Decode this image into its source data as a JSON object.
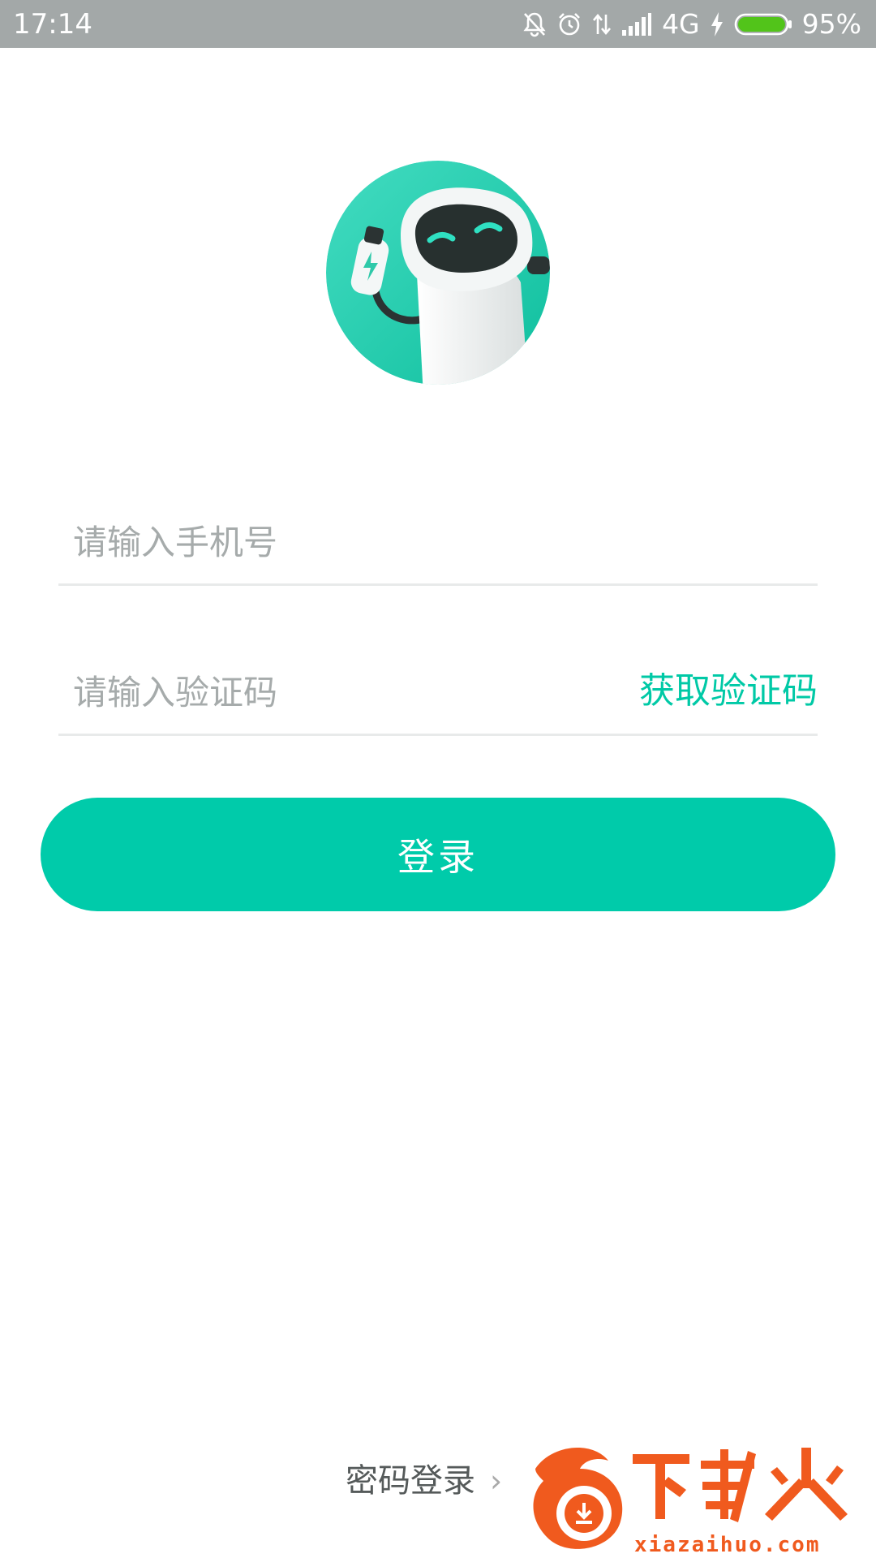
{
  "status_bar": {
    "time": "17:14",
    "network": "4G",
    "battery": "95%",
    "battery_level": 0.95,
    "icons": [
      "bell-muted-icon",
      "alarm-icon",
      "data-arrows-icon",
      "signal-icon",
      "charging-icon",
      "battery-icon"
    ]
  },
  "login": {
    "phone_placeholder": "请输入手机号",
    "code_placeholder": "请输入验证码",
    "get_code_label": "获取验证码",
    "submit_label": "登录",
    "password_login_label": "密码登录",
    "chevron": "›"
  },
  "watermark": {
    "brand": "下载火",
    "domain": "xiazaihuo.com"
  },
  "colors": {
    "accent": "#00cbaa",
    "status_bar": "#a3a8a8",
    "placeholder": "#a6abab",
    "divider": "#e8eaea",
    "watermark": "#f05a1e"
  }
}
